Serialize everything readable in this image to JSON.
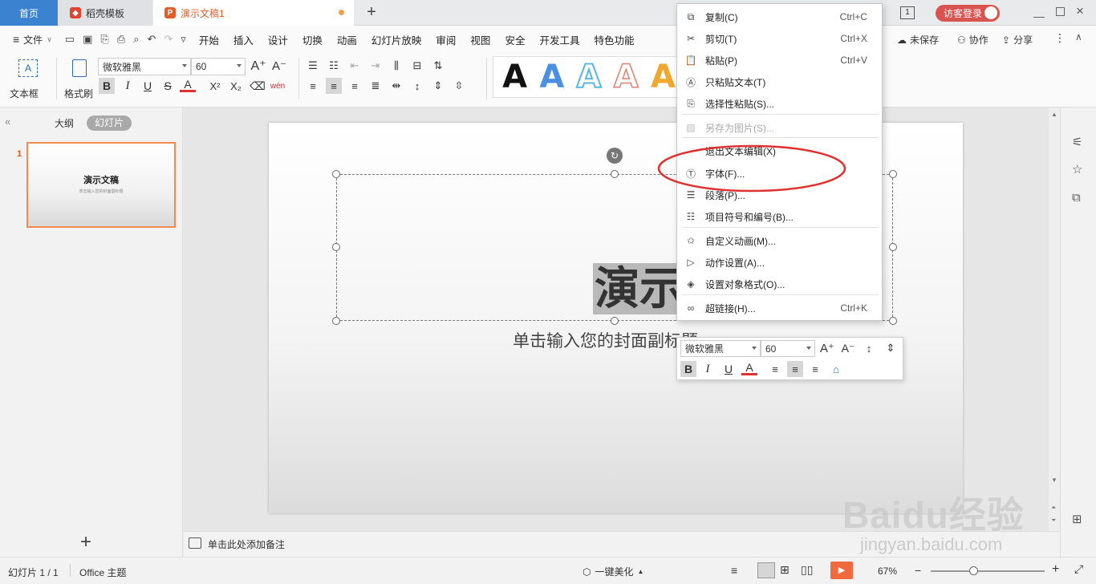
{
  "tabs": {
    "home": "首页",
    "templates": "稻壳模板",
    "document": "演示文稿1",
    "new_tab": "+"
  },
  "titlebar": {
    "page_count_badge": "1",
    "login": "访客登录"
  },
  "menubar": {
    "file": "文件",
    "items": [
      "开始",
      "插入",
      "设计",
      "切换",
      "动画",
      "幻灯片放映",
      "审阅",
      "视图",
      "安全",
      "开发工具",
      "特色功能"
    ],
    "unsaved": "未保存",
    "collaborate": "协作",
    "share": "分享"
  },
  "ribbon": {
    "textbox_label": "文本框",
    "format_painter_label": "格式刷",
    "font_name": "微软雅黑",
    "font_size": "60",
    "art_letter": "A",
    "phonetic": "wén"
  },
  "left_panel": {
    "outline_tab": "大纲",
    "slides_tab": "幻灯片",
    "slide_number": "1",
    "thumb_title": "演示文稿",
    "thumb_subtitle": "单击输入您的封面副标题",
    "add_slide": "+"
  },
  "slide": {
    "title": "演示文稿",
    "subtitle": "单击输入您的封面副标题",
    "notes_placeholder": "单击此处添加备注"
  },
  "context_menu": {
    "items": [
      {
        "label": "复制(C)",
        "shortcut": "Ctrl+C",
        "icon": "copy-icon",
        "disabled": false
      },
      {
        "label": "剪切(T)",
        "shortcut": "Ctrl+X",
        "icon": "cut-icon",
        "disabled": false
      },
      {
        "label": "粘贴(P)",
        "shortcut": "Ctrl+V",
        "icon": "paste-icon",
        "disabled": false
      },
      {
        "label": "只粘贴文本(T)",
        "shortcut": "",
        "icon": "paste-text-icon",
        "disabled": false
      },
      {
        "label": "选择性粘贴(S)...",
        "shortcut": "",
        "icon": "paste-special-icon",
        "disabled": false
      },
      {
        "label": "另存为图片(S)...",
        "shortcut": "",
        "icon": "save-image-icon",
        "disabled": true
      },
      {
        "label": "退出文本编辑(X)",
        "shortcut": "",
        "icon": "",
        "disabled": false
      },
      {
        "label": "字体(F)...",
        "shortcut": "",
        "icon": "font-icon",
        "disabled": false
      },
      {
        "label": "段落(P)...",
        "shortcut": "",
        "icon": "paragraph-icon",
        "disabled": false
      },
      {
        "label": "项目符号和编号(B)...",
        "shortcut": "",
        "icon": "bullets-icon",
        "disabled": false
      },
      {
        "label": "自定义动画(M)...",
        "shortcut": "",
        "icon": "animation-icon",
        "disabled": false
      },
      {
        "label": "动作设置(A)...",
        "shortcut": "",
        "icon": "action-icon",
        "disabled": false
      },
      {
        "label": "设置对象格式(O)...",
        "shortcut": "",
        "icon": "format-object-icon",
        "disabled": false
      },
      {
        "label": "超链接(H)...",
        "shortcut": "Ctrl+K",
        "icon": "hyperlink-icon",
        "disabled": false
      }
    ]
  },
  "mini_toolbar": {
    "font_name": "微软雅黑",
    "font_size": "60"
  },
  "statusbar": {
    "slide_counter": "幻灯片 1 / 1",
    "theme": "Office 主题",
    "beautify": "一键美化",
    "zoom": "67%"
  },
  "watermark": {
    "brand": "Baidu经验",
    "url": "jingyan.baidu.com"
  },
  "colors": {
    "accent_blue": "#3b82d1",
    "tab_orange": "#e05e2a",
    "highlight_ring": "#e03030",
    "play_button": "#f06a3e",
    "login_badge": "#d9534f"
  }
}
